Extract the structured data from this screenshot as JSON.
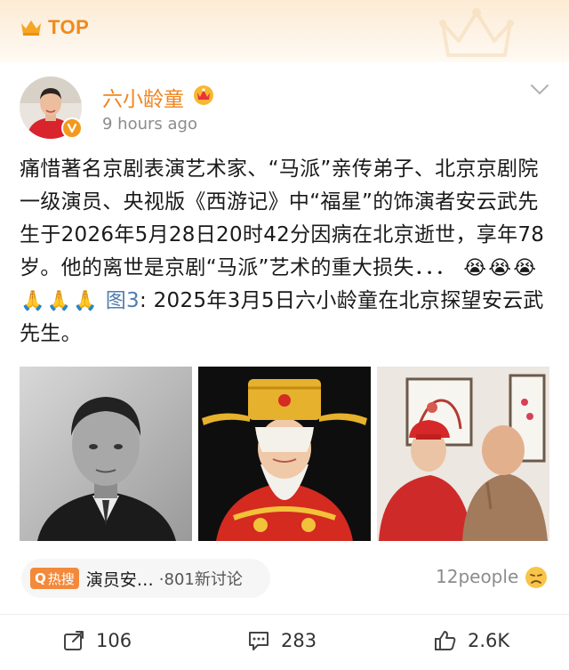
{
  "banner": {
    "label": "TOP"
  },
  "author": {
    "name": "六小龄童",
    "time": "9 hours ago"
  },
  "post": {
    "text_main": "痛惜著名京剧表演艺术家、“马派”亲传弟子、北京京剧院一级演员、央视版《西游记》中“福星”的饰演者安云武先生于2026年5月28日20时42分因病在北京逝世，享年78岁。他的离世是京剧“马派”艺术的重大损失．．．",
    "emojis": [
      "😭",
      "😭",
      "😭",
      "🙏",
      "🙏",
      "🙏"
    ],
    "pic_ref": "图3",
    "text_tail": ": 2025年3月5日六小龄童在北京探望安云武先生。"
  },
  "images": [
    {
      "name": "portrait-bw"
    },
    {
      "name": "fuxing-costume"
    },
    {
      "name": "visit-photo",
      "watermark": ""
    }
  ],
  "topic": {
    "tag": "热搜",
    "name": "演员安…",
    "count": "·801新讨论"
  },
  "reactions": {
    "people": "12people"
  },
  "actions": {
    "repost": "106",
    "comment": "283",
    "like": "2.6K"
  },
  "colors": {
    "accent": "#f0841e",
    "link": "#507daf",
    "hot": "#f3893a"
  }
}
